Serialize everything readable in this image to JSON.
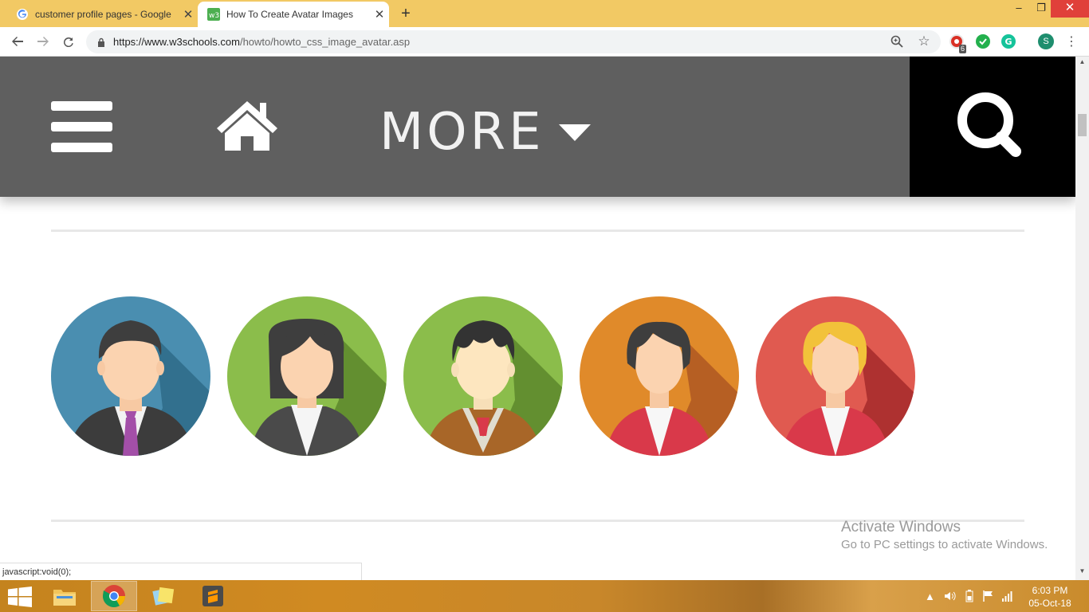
{
  "browser": {
    "tabs": [
      {
        "title": "customer profile pages - Google",
        "active": false,
        "favicon": "google-g-icon"
      },
      {
        "title": "How To Create Avatar Images",
        "active": true,
        "favicon": "w3schools-icon"
      }
    ],
    "url_host": "https://www.w3schools.com",
    "url_path": "/howto/howto_css_image_avatar.asp",
    "profile_initial": "S",
    "extension_badge": "6"
  },
  "page": {
    "nav": {
      "more_label": "MORE"
    },
    "status_text": "javascript:void(0);",
    "avatars": [
      {
        "name": "Male avatar with purple tie",
        "bg": "#4a8eb0"
      },
      {
        "name": "Female avatar in grey blazer",
        "bg": "#8bbd4b"
      },
      {
        "name": "Young male avatar in brown sweater",
        "bg": "#8bbd4b"
      },
      {
        "name": "Female avatar in red jacket",
        "bg": "#e08a2a"
      },
      {
        "name": "Blonde female avatar in red jacket",
        "bg": "#e05a50"
      }
    ]
  },
  "watermark": {
    "title": "Activate Windows",
    "subtitle": "Go to PC settings to activate Windows."
  },
  "taskbar": {
    "apps": [
      "file-explorer-icon",
      "chrome-icon",
      "sticky-notes-icon",
      "sublime-text-icon"
    ],
    "time": "6:03 PM",
    "date": "05-Oct-18"
  }
}
